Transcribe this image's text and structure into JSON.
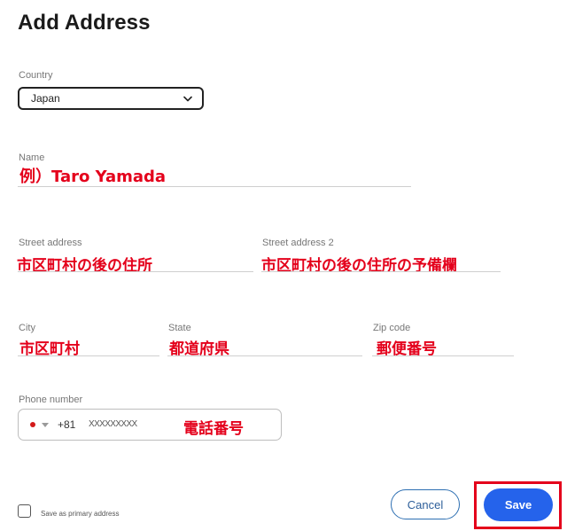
{
  "header": {
    "title": "Add Address"
  },
  "country": {
    "label": "Country",
    "value": "Japan"
  },
  "name": {
    "label": "Name",
    "annotation": "例）Taro Yamada"
  },
  "street1": {
    "label": "Street address",
    "annotation": "市区町村の後の住所"
  },
  "street2": {
    "label": "Street address 2",
    "annotation": "市区町村の後の住所の予備欄"
  },
  "city": {
    "label": "City",
    "annotation": "市区町村"
  },
  "state": {
    "label": "State",
    "annotation": "都道府県"
  },
  "zip": {
    "label": "Zip code",
    "annotation": "郵便番号"
  },
  "phone": {
    "label": "Phone number",
    "country_code": "+81",
    "placeholder": "XXXXXXXXX",
    "annotation": "電話番号",
    "flag_icon": "japan-flag-icon"
  },
  "footer": {
    "primary_label": "Save as primary address",
    "cancel_label": "Cancel",
    "save_label": "Save"
  },
  "colors": {
    "accent": "#2563eb",
    "annotation_red": "#e4001b",
    "cancel_border": "#2d6fb2"
  }
}
